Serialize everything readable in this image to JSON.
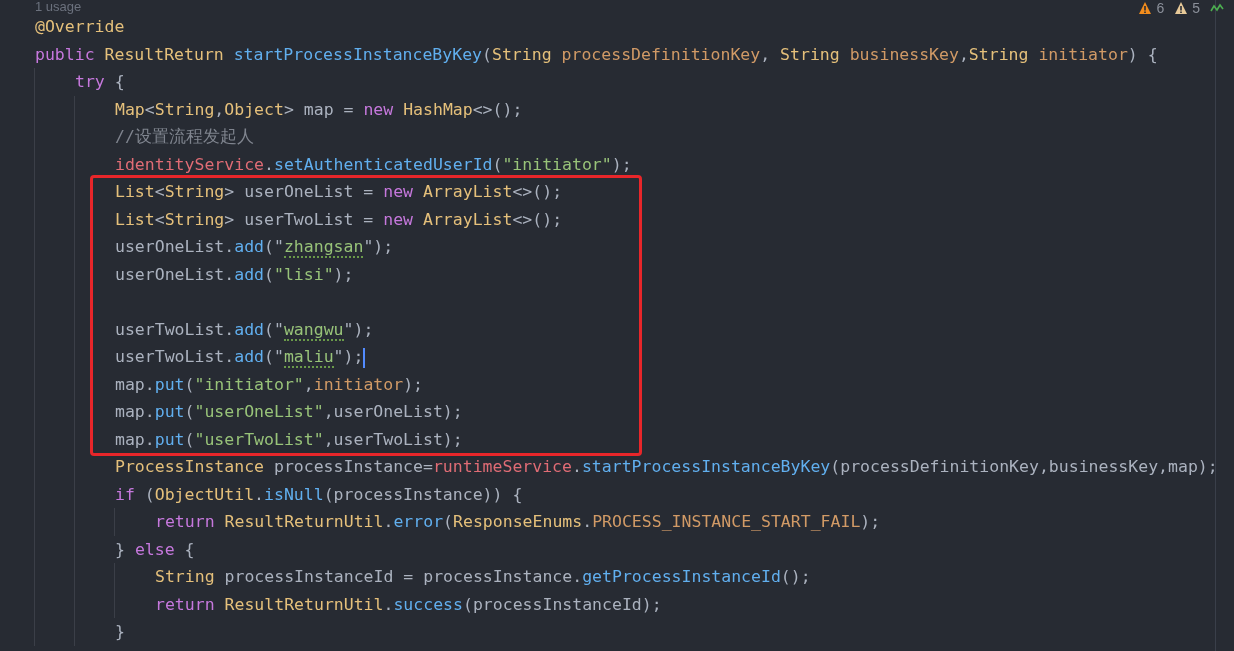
{
  "inspections": [
    {
      "kind": "error",
      "count": "6"
    },
    {
      "kind": "warning",
      "count": "5"
    }
  ],
  "code": [
    {
      "kind": "hint",
      "text": "1 usage"
    },
    {
      "kind": "line",
      "current": false,
      "tokens": [
        {
          "kind": "annotation",
          "t": "@Override"
        }
      ]
    },
    {
      "kind": "line",
      "current": false,
      "tokens": [
        {
          "kind": "kw",
          "t": "public "
        },
        {
          "kind": "type",
          "t": "ResultReturn "
        },
        {
          "kind": "method",
          "t": "startProcessInstanceByKey"
        },
        {
          "kind": "plain",
          "t": "("
        },
        {
          "kind": "type",
          "t": "String "
        },
        {
          "kind": "param",
          "t": "processDefinitionKey"
        },
        {
          "kind": "plain",
          "t": ", "
        },
        {
          "kind": "type",
          "t": "String "
        },
        {
          "kind": "param",
          "t": "businessKey"
        },
        {
          "kind": "plain",
          "t": ","
        },
        {
          "kind": "type",
          "t": "String "
        },
        {
          "kind": "param",
          "t": "initiator"
        },
        {
          "kind": "plain",
          "t": ") {"
        }
      ]
    },
    {
      "kind": "block",
      "children": [
        {
          "kind": "line",
          "current": false,
          "tokens": [
            {
              "kind": "kw",
              "t": "try"
            },
            {
              "kind": "plain",
              "t": " {"
            }
          ]
        },
        {
          "kind": "block",
          "children": [
            {
              "kind": "line",
              "current": false,
              "tokens": [
                {
                  "kind": "type",
                  "t": "Map"
                },
                {
                  "kind": "plain",
                  "t": "<"
                },
                {
                  "kind": "type",
                  "t": "String"
                },
                {
                  "kind": "plain",
                  "t": ","
                },
                {
                  "kind": "type",
                  "t": "Object"
                },
                {
                  "kind": "plain",
                  "t": "> map = "
                },
                {
                  "kind": "kw",
                  "t": "new "
                },
                {
                  "kind": "type",
                  "t": "HashMap"
                },
                {
                  "kind": "plain",
                  "t": "<>();"
                }
              ]
            },
            {
              "kind": "line",
              "current": false,
              "tokens": [
                {
                  "kind": "comment",
                  "t": "//设置流程发起人"
                }
              ]
            },
            {
              "kind": "line",
              "current": false,
              "tokens": [
                {
                  "kind": "field",
                  "t": "identityService"
                },
                {
                  "kind": "plain",
                  "t": "."
                },
                {
                  "kind": "method",
                  "t": "setAuthenticatedUserId"
                },
                {
                  "kind": "plain",
                  "t": "("
                },
                {
                  "kind": "str",
                  "t": "\"initiator\""
                },
                {
                  "kind": "plain",
                  "t": ");"
                }
              ]
            },
            {
              "kind": "annotation_box",
              "children": [
                {
                  "kind": "line",
                  "current": false,
                  "tokens": [
                    {
                      "kind": "type",
                      "t": "List"
                    },
                    {
                      "kind": "plain",
                      "t": "<"
                    },
                    {
                      "kind": "type",
                      "t": "String"
                    },
                    {
                      "kind": "plain",
                      "t": "> userOneList = "
                    },
                    {
                      "kind": "kw",
                      "t": "new "
                    },
                    {
                      "kind": "type",
                      "t": "ArrayList"
                    },
                    {
                      "kind": "plain",
                      "t": "<>();"
                    }
                  ]
                },
                {
                  "kind": "line",
                  "current": false,
                  "tokens": [
                    {
                      "kind": "type",
                      "t": "List"
                    },
                    {
                      "kind": "plain",
                      "t": "<"
                    },
                    {
                      "kind": "type",
                      "t": "String"
                    },
                    {
                      "kind": "plain",
                      "t": "> userTwoList = "
                    },
                    {
                      "kind": "kw",
                      "t": "new "
                    },
                    {
                      "kind": "type",
                      "t": "ArrayList"
                    },
                    {
                      "kind": "plain",
                      "t": "<>();"
                    }
                  ]
                },
                {
                  "kind": "line",
                  "current": false,
                  "tokens": [
                    {
                      "kind": "plain",
                      "t": "userOneList."
                    },
                    {
                      "kind": "method",
                      "t": "add"
                    },
                    {
                      "kind": "plain",
                      "t": "(\""
                    },
                    {
                      "kind": "str",
                      "t": "zhangsan",
                      "typo": true
                    },
                    {
                      "kind": "plain",
                      "t": "\");"
                    }
                  ]
                },
                {
                  "kind": "line",
                  "current": false,
                  "tokens": [
                    {
                      "kind": "plain",
                      "t": "userOneList."
                    },
                    {
                      "kind": "method",
                      "t": "add"
                    },
                    {
                      "kind": "plain",
                      "t": "("
                    },
                    {
                      "kind": "str",
                      "t": "\"lisi\""
                    },
                    {
                      "kind": "plain",
                      "t": ");"
                    }
                  ]
                },
                {
                  "kind": "blank"
                },
                {
                  "kind": "line",
                  "current": false,
                  "tokens": [
                    {
                      "kind": "plain",
                      "t": "userTwoList."
                    },
                    {
                      "kind": "method",
                      "t": "add"
                    },
                    {
                      "kind": "plain",
                      "t": "(\""
                    },
                    {
                      "kind": "str",
                      "t": "wangwu",
                      "typo": true
                    },
                    {
                      "kind": "plain",
                      "t": "\");"
                    }
                  ]
                },
                {
                  "kind": "line",
                  "current": true,
                  "tokens": [
                    {
                      "kind": "plain",
                      "t": "userTwoList."
                    },
                    {
                      "kind": "method",
                      "t": "add"
                    },
                    {
                      "kind": "plain",
                      "t": "(\""
                    },
                    {
                      "kind": "str",
                      "t": "maliu",
                      "typo": true
                    },
                    {
                      "kind": "plain",
                      "t": "\");"
                    }
                  ]
                },
                {
                  "kind": "line",
                  "current": false,
                  "tokens": [
                    {
                      "kind": "plain",
                      "t": "map."
                    },
                    {
                      "kind": "method",
                      "t": "put"
                    },
                    {
                      "kind": "plain",
                      "t": "("
                    },
                    {
                      "kind": "str",
                      "t": "\"initiator\""
                    },
                    {
                      "kind": "plain",
                      "t": ","
                    },
                    {
                      "kind": "param",
                      "t": "initiator"
                    },
                    {
                      "kind": "plain",
                      "t": ");"
                    }
                  ]
                },
                {
                  "kind": "line",
                  "current": false,
                  "tokens": [
                    {
                      "kind": "plain",
                      "t": "map."
                    },
                    {
                      "kind": "method",
                      "t": "put"
                    },
                    {
                      "kind": "plain",
                      "t": "("
                    },
                    {
                      "kind": "str",
                      "t": "\"userOneList\""
                    },
                    {
                      "kind": "plain",
                      "t": ",userOneList);"
                    }
                  ]
                },
                {
                  "kind": "line",
                  "current": false,
                  "tokens": [
                    {
                      "kind": "plain",
                      "t": "map."
                    },
                    {
                      "kind": "method",
                      "t": "put"
                    },
                    {
                      "kind": "plain",
                      "t": "("
                    },
                    {
                      "kind": "str",
                      "t": "\"userTwoList\""
                    },
                    {
                      "kind": "plain",
                      "t": ",userTwoList);"
                    }
                  ]
                }
              ]
            },
            {
              "kind": "line",
              "current": false,
              "tokens": [
                {
                  "kind": "type",
                  "t": "ProcessInstance"
                },
                {
                  "kind": "plain",
                  "t": " processInstance="
                },
                {
                  "kind": "field",
                  "t": "runtimeService"
                },
                {
                  "kind": "plain",
                  "t": "."
                },
                {
                  "kind": "method",
                  "t": "startProcessInstanceByKey"
                },
                {
                  "kind": "plain",
                  "t": "(processDefinitionKey,businessKey,map);"
                }
              ]
            },
            {
              "kind": "line",
              "current": false,
              "tokens": [
                {
                  "kind": "kw",
                  "t": "if"
                },
                {
                  "kind": "plain",
                  "t": " ("
                },
                {
                  "kind": "type",
                  "t": "ObjectUtil"
                },
                {
                  "kind": "plain",
                  "t": "."
                },
                {
                  "kind": "method",
                  "t": "isNull"
                },
                {
                  "kind": "plain",
                  "t": "(processInstance)) {"
                }
              ]
            },
            {
              "kind": "block",
              "children": [
                {
                  "kind": "line",
                  "current": false,
                  "tokens": [
                    {
                      "kind": "kw",
                      "t": "return "
                    },
                    {
                      "kind": "type",
                      "t": "ResultReturnUtil"
                    },
                    {
                      "kind": "plain",
                      "t": "."
                    },
                    {
                      "kind": "method",
                      "t": "error"
                    },
                    {
                      "kind": "plain",
                      "t": "("
                    },
                    {
                      "kind": "type",
                      "t": "ResponseEnums"
                    },
                    {
                      "kind": "plain",
                      "t": "."
                    },
                    {
                      "kind": "constant",
                      "t": "PROCESS_INSTANCE_START_FAIL"
                    },
                    {
                      "kind": "plain",
                      "t": ");"
                    }
                  ]
                }
              ]
            },
            {
              "kind": "line",
              "current": false,
              "tokens": [
                {
                  "kind": "plain",
                  "t": "} "
                },
                {
                  "kind": "kw",
                  "t": "else"
                },
                {
                  "kind": "plain",
                  "t": " {"
                }
              ]
            },
            {
              "kind": "block",
              "children": [
                {
                  "kind": "line",
                  "current": false,
                  "tokens": [
                    {
                      "kind": "type",
                      "t": "String"
                    },
                    {
                      "kind": "plain",
                      "t": " processInstanceId = processInstance."
                    },
                    {
                      "kind": "method",
                      "t": "getProcessInstanceId"
                    },
                    {
                      "kind": "plain",
                      "t": "();"
                    }
                  ]
                },
                {
                  "kind": "line",
                  "current": false,
                  "tokens": [
                    {
                      "kind": "kw",
                      "t": "return "
                    },
                    {
                      "kind": "type",
                      "t": "ResultReturnUtil"
                    },
                    {
                      "kind": "plain",
                      "t": "."
                    },
                    {
                      "kind": "method",
                      "t": "success"
                    },
                    {
                      "kind": "plain",
                      "t": "(processInstanceId);"
                    }
                  ]
                }
              ]
            },
            {
              "kind": "line",
              "current": false,
              "tokens": [
                {
                  "kind": "plain",
                  "t": "}"
                }
              ]
            }
          ]
        }
      ]
    }
  ]
}
